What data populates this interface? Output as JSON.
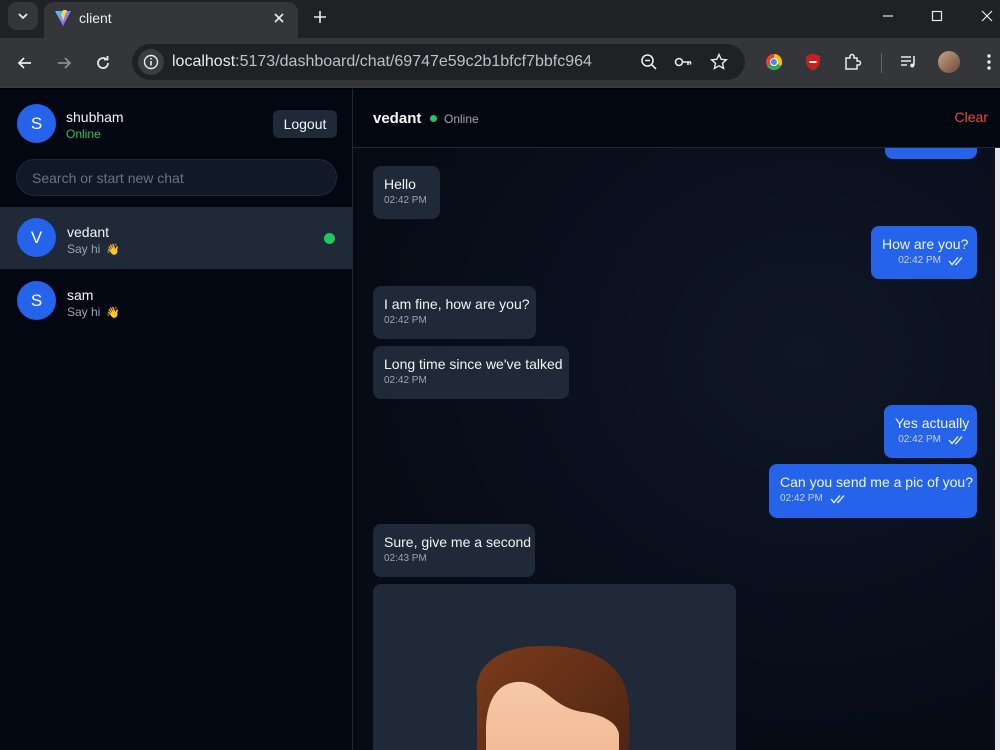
{
  "browser": {
    "tab_title": "client",
    "url_host": "localhost",
    "url_path": ":5173/dashboard/chat/69747e59c2b1bfcf7bbfc964"
  },
  "sidebar": {
    "user_initial": "S",
    "user_name": "shubham",
    "user_status": "Online",
    "logout_label": "Logout",
    "search_placeholder": "Search or start new chat",
    "contacts": [
      {
        "initial": "V",
        "name": "vedant",
        "preview": "Say hi",
        "emoji": "👋",
        "online": true,
        "active": true
      },
      {
        "initial": "S",
        "name": "sam",
        "preview": "Say hi",
        "emoji": "👋",
        "online": false,
        "active": false
      }
    ]
  },
  "chat": {
    "peer_name": "vedant",
    "peer_status": "Online",
    "clear_label": "Clear",
    "messages": [
      {
        "dir": "in",
        "text": "Hello",
        "time": "02:42 PM"
      },
      {
        "dir": "out",
        "text": "How are you?",
        "time": "02:42 PM",
        "read": true
      },
      {
        "dir": "in",
        "text": "I am fine, how are you?",
        "time": "02:42 PM"
      },
      {
        "dir": "in",
        "text": "Long time since we've talked",
        "time": "02:42 PM"
      },
      {
        "dir": "out",
        "text": "Yes actually",
        "time": "02:42 PM",
        "read": true
      },
      {
        "dir": "out",
        "text": "Can you send me a pic of you?",
        "time": "02:42 PM",
        "read": true
      },
      {
        "dir": "in",
        "text": "Sure, give me a second",
        "time": "02:43 PM"
      }
    ],
    "image_message": "avatar-image"
  },
  "colors": {
    "accent": "#2563eb",
    "online": "#22c55e",
    "danger": "#ef4444",
    "bubble_in": "#1f2937",
    "background": "#030712"
  }
}
